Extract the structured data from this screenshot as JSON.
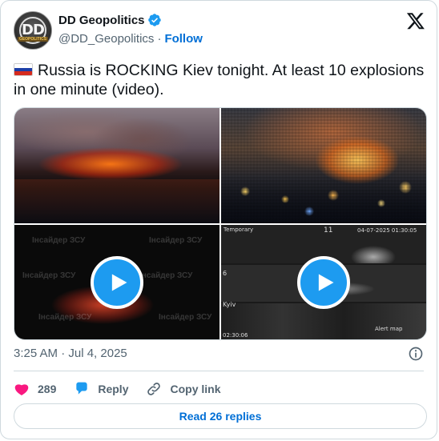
{
  "author": {
    "display_name": "DD Geopolitics",
    "avatar_text": "DD",
    "avatar_subtext": "GEOPOLITICS",
    "handle": "@DD_Geopolitics",
    "separator": "·",
    "follow_label": "Follow",
    "verified": true
  },
  "tweet": {
    "flag": "russia-flag",
    "text": "Russia is ROCKING Kiev tonight. At least 10 explosions in one minute (video)."
  },
  "media": {
    "tiles": [
      {
        "type": "image",
        "watermark": ""
      },
      {
        "type": "image",
        "watermark": ""
      },
      {
        "type": "video",
        "watermark": "Інсайдер ЗСУ"
      },
      {
        "type": "video",
        "watermark": "",
        "cam_labels": [
          "Temporary",
          "11",
          "04-07-2025 01:30:05",
          "Kyiv",
          "6",
          "02:30:06",
          "Alert map"
        ]
      }
    ]
  },
  "meta": {
    "timestamp": "3:25 AM · Jul 4, 2025"
  },
  "actions": {
    "like_count": "289",
    "reply_label": "Reply",
    "copy_link_label": "Copy link"
  },
  "read_replies_label": "Read 26 replies",
  "colors": {
    "accent": "#1d9bf0",
    "link": "#006fd6",
    "like": "#f91880",
    "secondary_text": "#536471",
    "border": "#cfd9de"
  }
}
